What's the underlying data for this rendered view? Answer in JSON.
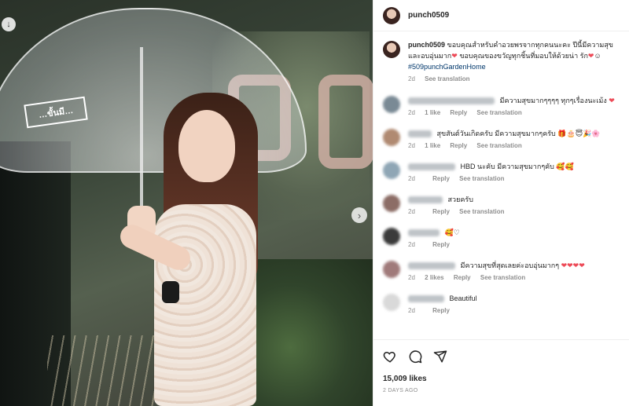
{
  "post": {
    "username": "punch0509",
    "image_badge": "…ขั้นมี…",
    "caption_text": "ขอบคุณสำหรับคำอวยพรจากทุกคนนะคะ ปีนี้มีความสุขและอบอุ่นมาก",
    "caption_text2": "ขอบคุณของขวัญทุกชิ้นที่มอบให้ด้วยน่า รัก",
    "hashtag": "#509punchGardenHome",
    "caption_time": "2d",
    "see_translation": "See translation"
  },
  "comments": [
    {
      "text": "มีความสุขมากๆๆๆๆ ทุกๆเรื่องนะเม้ง",
      "time": "2d",
      "likes": "1 like",
      "reply": "Reply",
      "translate": "See translation",
      "avatar_color": "#7a8a95",
      "name_w": 110
    },
    {
      "text": "สุขสันต์วันเกิดครับ มีความสุขมากๆครับ",
      "time": "2d",
      "likes": "1 like",
      "reply": "Reply",
      "translate": "See translation",
      "avatar_color": "#b08a72",
      "name_w": 30
    },
    {
      "text": "HBD นะคับ มีความสุขมากๆคับ",
      "time": "2d",
      "likes": "",
      "reply": "Reply",
      "translate": "See translation",
      "avatar_color": "#8fa6b5",
      "name_w": 60
    },
    {
      "text": "สวยครับ",
      "time": "2d",
      "likes": "",
      "reply": "Reply",
      "translate": "See translation",
      "avatar_color": "#8c6d66",
      "name_w": 44
    },
    {
      "text": "",
      "time": "2d",
      "likes": "",
      "reply": "Reply",
      "translate": "",
      "avatar_color": "#3b3b3b",
      "name_w": 40
    },
    {
      "text": "มีความสุขที่สุดเลยค่ะอบอุ่นมากๆ",
      "time": "2d",
      "likes": "2 likes",
      "reply": "Reply",
      "translate": "See translation",
      "avatar_color": "#a07a7a",
      "name_w": 60
    },
    {
      "text": "Beautiful",
      "time": "2d",
      "likes": "",
      "reply": "Reply",
      "translate": "",
      "avatar_color": "#d9d9d9",
      "name_w": 46
    }
  ],
  "footer": {
    "likes": "15,009 likes",
    "date": "2 DAYS AGO"
  },
  "icons": {
    "download": "download-icon",
    "next": "chevron-right-icon",
    "like": "heart-icon",
    "comment": "comment-icon",
    "share": "send-icon"
  }
}
